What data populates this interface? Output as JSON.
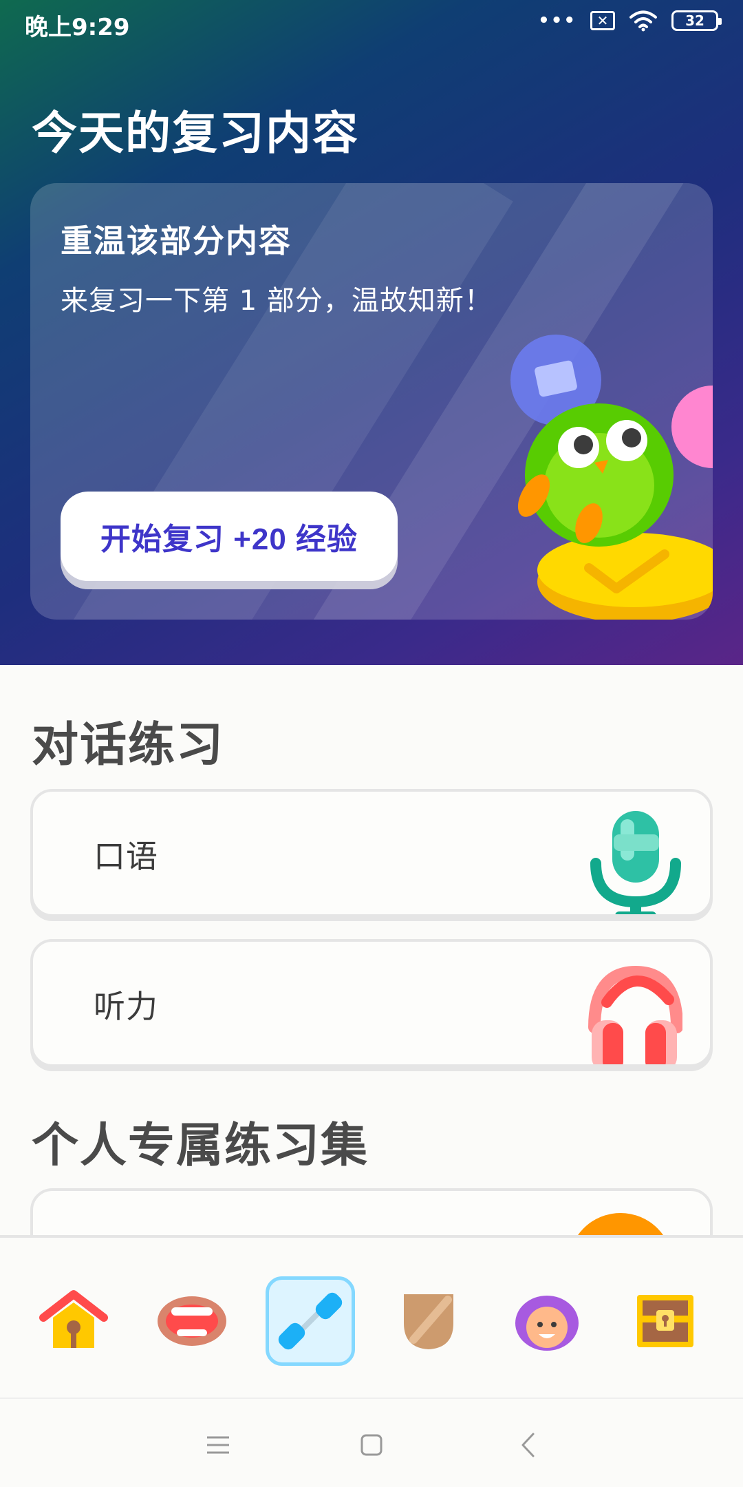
{
  "status_bar": {
    "time": "晚上9:29",
    "dots": "•••",
    "sim_glyph": "✕",
    "battery": "32"
  },
  "hero": {
    "title": "今天的复习内容",
    "card": {
      "heading": "重温该部分内容",
      "description": "来复习一下第 1 部分，温故知新！",
      "button_label": "开始复习 +20 经验"
    }
  },
  "conversation": {
    "title": "对话练习",
    "items": [
      {
        "label": "口语",
        "icon": "microphone-icon"
      },
      {
        "label": "听力",
        "icon": "headphones-icon"
      }
    ]
  },
  "personal": {
    "title": "个人专属练习集"
  },
  "tabs": [
    {
      "name": "home",
      "icon": "house-icon"
    },
    {
      "name": "speak",
      "icon": "mouth-icon"
    },
    {
      "name": "practice",
      "icon": "dumbbell-icon",
      "active": true
    },
    {
      "name": "league",
      "icon": "shield-icon"
    },
    {
      "name": "profile",
      "icon": "avatar-icon"
    },
    {
      "name": "shop",
      "icon": "treasure-chest-icon"
    }
  ],
  "colors": {
    "accent": "#3E35C9",
    "active_tab_bg": "#DDF4FF",
    "active_tab_border": "#84D8FF",
    "section_text": "#4A4A4A"
  }
}
